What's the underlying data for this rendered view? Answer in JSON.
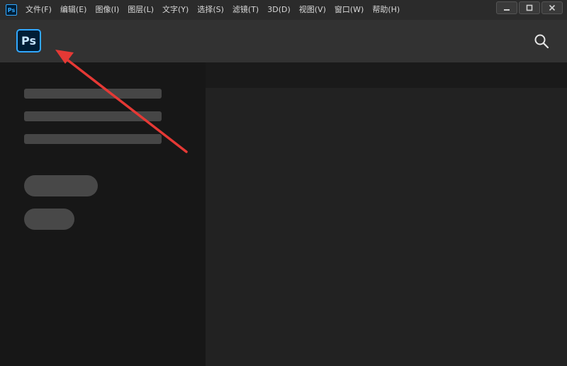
{
  "app": {
    "icon_text": "Ps"
  },
  "menu": {
    "items": [
      "文件(F)",
      "编辑(E)",
      "图像(I)",
      "图层(L)",
      "文字(Y)",
      "选择(S)",
      "滤镜(T)",
      "3D(D)",
      "视图(V)",
      "窗口(W)",
      "帮助(H)"
    ]
  },
  "window_controls": {
    "minimize": "minimize-icon",
    "maximize": "maximize-icon",
    "close": "close-icon"
  },
  "home": {
    "logo_text": "Ps",
    "search_icon": "search-icon"
  },
  "colors": {
    "accent": "#31a8ff",
    "annotation_arrow": "#e53935"
  }
}
